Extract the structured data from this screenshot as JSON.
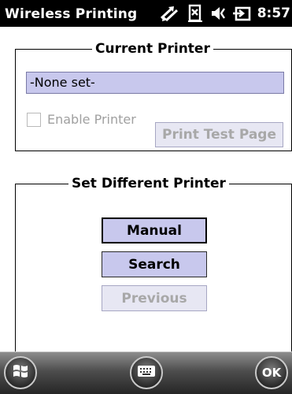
{
  "title_bar": {
    "title": "Wireless Printing",
    "time": "8:57",
    "icons": [
      "connectivity-icon",
      "signal-icon",
      "volume-icon",
      "battery-icon"
    ]
  },
  "current_printer": {
    "group_title": "Current Printer",
    "printer_value": "-None set-",
    "enable_printer_label": "Enable Printer",
    "enable_printer_checked": false,
    "print_test_page_label": "Print Test Page"
  },
  "set_different_printer": {
    "group_title": "Set Different Printer",
    "manual_label": "Manual",
    "search_label": "Search",
    "previous_label": "Previous"
  },
  "bottom_bar": {
    "ok_label": "OK",
    "icons": [
      "start-icon",
      "keyboard-icon"
    ]
  },
  "colors": {
    "title_bar_bg": "#000000",
    "button_fill": "#c8c8ed",
    "disabled_text": "#a8a8a8"
  }
}
